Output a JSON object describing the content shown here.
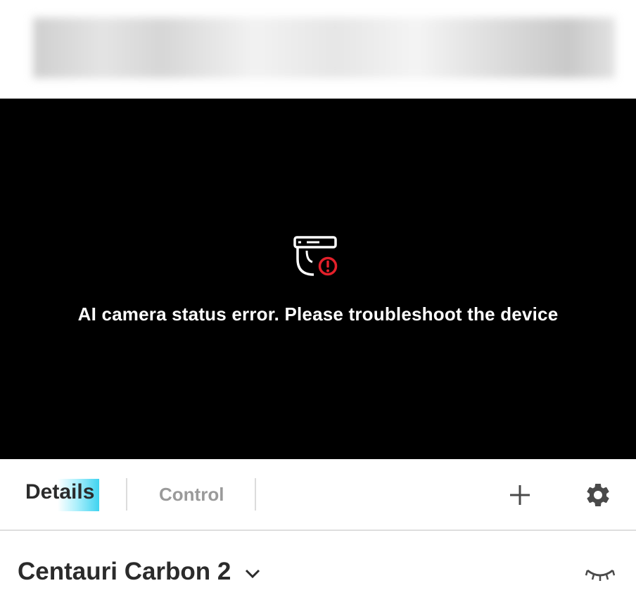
{
  "video": {
    "error_message": "AI camera status error. Please troubleshoot the device",
    "icon": "camera-error-icon",
    "error_color": "#e3202a"
  },
  "tabs": [
    {
      "label": "Details",
      "active": true
    },
    {
      "label": "Control",
      "active": false
    }
  ],
  "toolbar": {
    "add_icon": "plus-icon",
    "settings_icon": "gear-icon"
  },
  "device": {
    "name": "Centauri Carbon 2",
    "dropdown_icon": "chevron-down-icon",
    "visibility_icon": "eye-closed-icon"
  },
  "colors": {
    "tab_highlight": "#3fd3f0",
    "text_dark": "#2b2b2b",
    "text_muted": "#9a9a9a"
  }
}
